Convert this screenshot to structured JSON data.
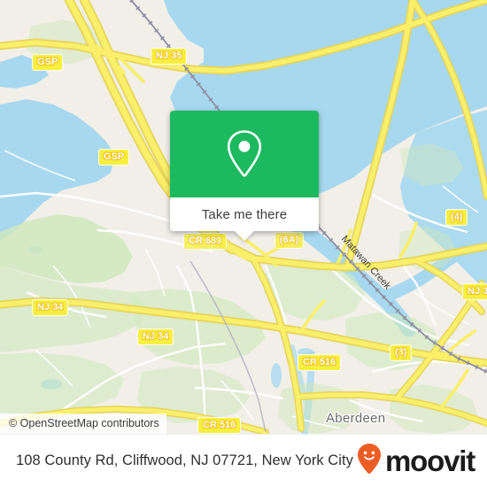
{
  "map": {
    "attribution": "© OpenStreetMap contributors",
    "water_label": "Matawan Creek",
    "place_labels": [
      {
        "name": "Aberdeen",
        "text": "Aberdeen"
      }
    ],
    "shields": [
      {
        "id": "gsp-north",
        "text": "GSP"
      },
      {
        "id": "nj35",
        "text": "NJ 35"
      },
      {
        "id": "gsp-mid",
        "text": "GSP"
      },
      {
        "id": "cr689",
        "text": "CR 689"
      },
      {
        "id": "exit6a",
        "text": "(6A)"
      },
      {
        "id": "exit4",
        "text": "(4)"
      },
      {
        "id": "nj34-west",
        "text": "NJ 34"
      },
      {
        "id": "nj34-mid",
        "text": "NJ 34"
      },
      {
        "id": "nj35-east",
        "text": "NJ 3"
      },
      {
        "id": "cr516-mid",
        "text": "CR 516"
      },
      {
        "id": "exit3",
        "text": "(3)"
      },
      {
        "id": "cr516-bot",
        "text": "CR 516"
      }
    ],
    "colors": {
      "water": "#a8d8ef",
      "land": "#f2efe9",
      "park": "#cfe8bd",
      "motorway": "#f7e05a",
      "road": "#ffffff",
      "rail": "#7a7a8c"
    }
  },
  "popup": {
    "cta_label": "Take me there",
    "icon": "map-pin-icon",
    "accent_color": "#1db95f"
  },
  "footer": {
    "address": "108 County Rd, Cliffwood, NJ 07721, New York City",
    "brand_name": "moovit",
    "brand_icon": "moovit-smiley-pin-icon",
    "brand_color": "#eb5d24"
  }
}
